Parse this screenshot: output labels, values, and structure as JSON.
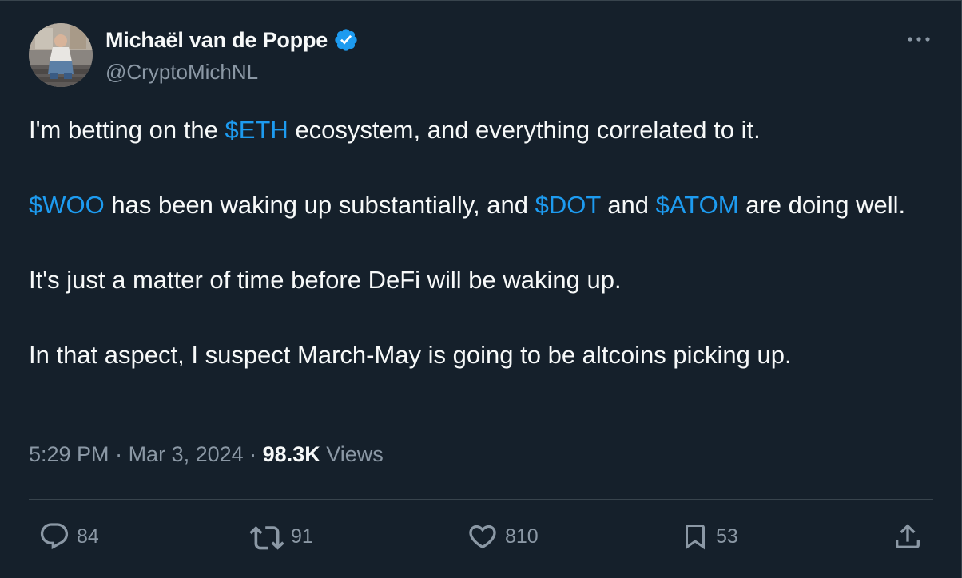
{
  "author": {
    "display_name": "Michaël van de Poppe",
    "handle": "@CryptoMichNL",
    "verified": true
  },
  "tweet": {
    "paragraphs": [
      [
        {
          "text": "I'm betting on the ",
          "type": "text"
        },
        {
          "text": "$ETH",
          "type": "cashtag"
        },
        {
          "text": " ecosystem, and everything correlated to it.",
          "type": "text"
        }
      ],
      [
        {
          "text": "$WOO",
          "type": "cashtag"
        },
        {
          "text": " has been waking up substantially, and ",
          "type": "text"
        },
        {
          "text": "$DOT",
          "type": "cashtag"
        },
        {
          "text": " and ",
          "type": "text"
        },
        {
          "text": "$ATOM",
          "type": "cashtag"
        },
        {
          "text": " are doing well.",
          "type": "text"
        }
      ],
      [
        {
          "text": "It's just a matter of time before DeFi will be waking up.",
          "type": "text"
        }
      ],
      [
        {
          "text": "In that aspect, I suspect March-May is going to be altcoins picking up.",
          "type": "text"
        }
      ]
    ]
  },
  "meta": {
    "time": "5:29 PM",
    "separator": " · ",
    "date": "Mar 3, 2024",
    "views_count": "98.3K",
    "views_label": " Views"
  },
  "actions": {
    "replies": "84",
    "reposts": "91",
    "likes": "810",
    "bookmarks": "53"
  },
  "colors": {
    "background": "#15202b",
    "text": "#f7f9f9",
    "secondary": "#8b98a5",
    "accent": "#1d9bf0",
    "divider": "#38444d"
  },
  "icons": {
    "verified": "verified-badge-icon",
    "more": "more-dots-icon",
    "reply": "reply-bubble-icon",
    "repost": "repost-arrows-icon",
    "like": "heart-icon",
    "bookmark": "bookmark-icon",
    "share": "share-upload-icon"
  }
}
